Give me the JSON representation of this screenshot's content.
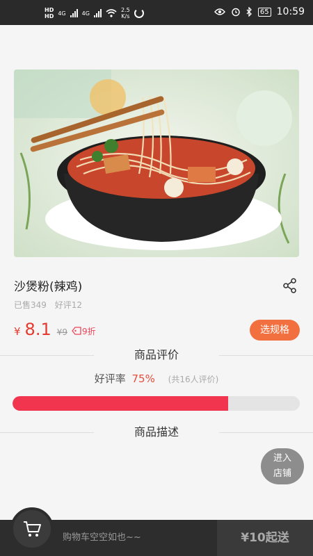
{
  "status_bar": {
    "hd1": "HD",
    "hd2": "HD",
    "net_type1": "4G",
    "net_type2": "4G",
    "speed_value": "2.5",
    "speed_unit": "K/s",
    "battery": "65",
    "time": "10:59"
  },
  "product": {
    "image_icon": "noodle-dish-photo",
    "name": "沙煲粉(辣鸡)",
    "sold": "已售349",
    "good_reviews": "好评12",
    "currency": "¥",
    "price": "8.1",
    "original_price": "¥9",
    "discount": "9折",
    "spec_button": "选规格"
  },
  "reviews": {
    "heading": "商品评价",
    "rate_label": "好评率",
    "rate_value": "75%",
    "rate_fraction": 0.75,
    "count_text": "(共16人评价)"
  },
  "description": {
    "heading": "商品描述"
  },
  "store_button": {
    "line1": "进入",
    "line2": "店铺"
  },
  "cart": {
    "icon": "shopping-cart-icon",
    "empty_text": "购物车空空如也~~",
    "min_order": "¥10起送"
  },
  "colors": {
    "accent_red": "#e63a2e",
    "spec_orange": "#f2703f",
    "progress_red": "#f2354f"
  }
}
